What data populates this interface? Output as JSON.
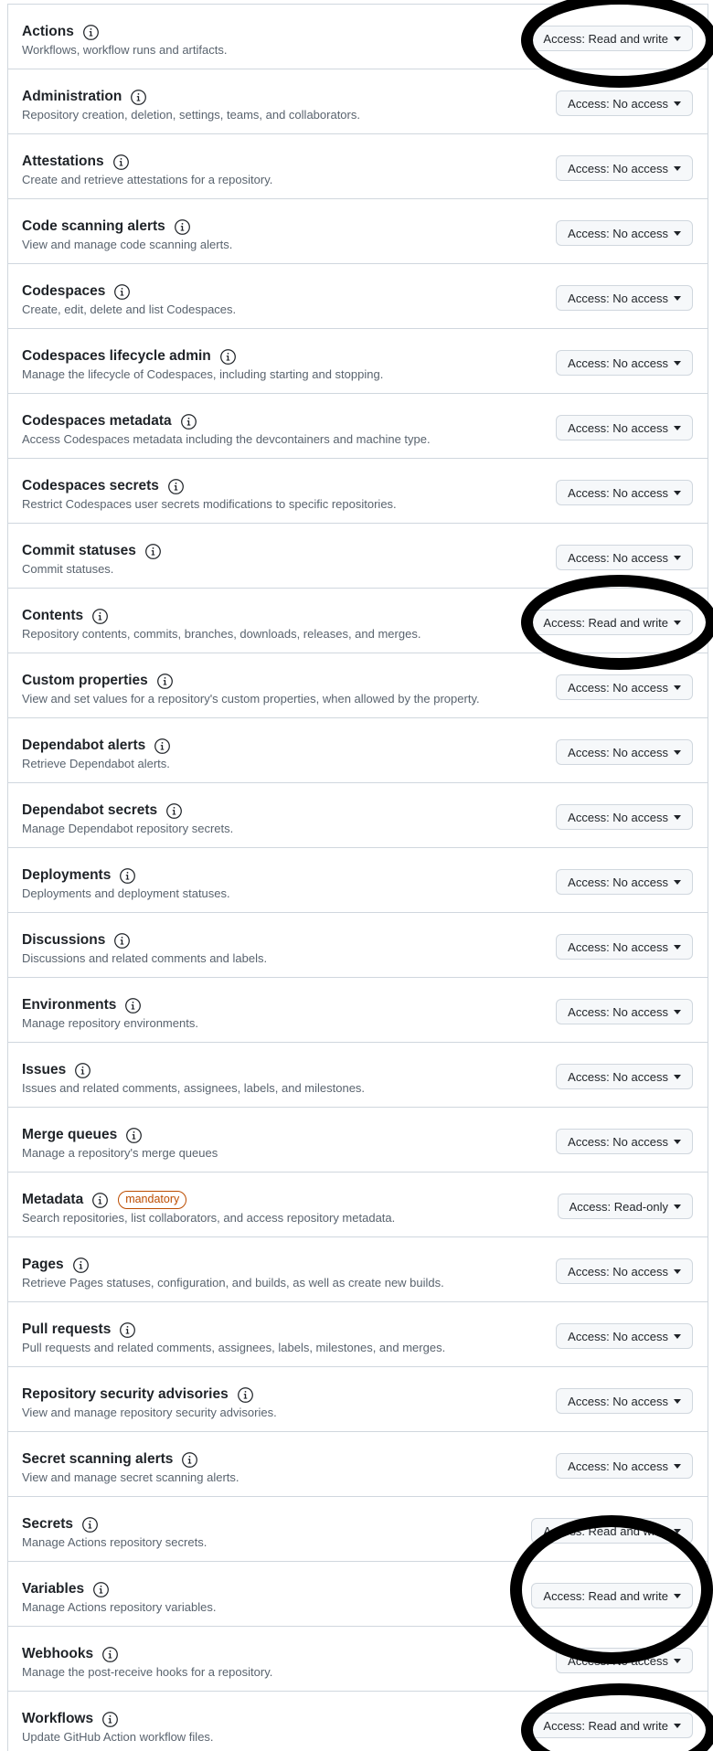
{
  "permissions": [
    {
      "name": "Actions",
      "description": "Workflows, workflow runs and artifacts.",
      "access": "Access: Read and write"
    },
    {
      "name": "Administration",
      "description": "Repository creation, deletion, settings, teams, and collaborators.",
      "access": "Access: No access"
    },
    {
      "name": "Attestations",
      "description": "Create and retrieve attestations for a repository.",
      "access": "Access: No access"
    },
    {
      "name": "Code scanning alerts",
      "description": "View and manage code scanning alerts.",
      "access": "Access: No access"
    },
    {
      "name": "Codespaces",
      "description": "Create, edit, delete and list Codespaces.",
      "access": "Access: No access"
    },
    {
      "name": "Codespaces lifecycle admin",
      "description": "Manage the lifecycle of Codespaces, including starting and stopping.",
      "access": "Access: No access"
    },
    {
      "name": "Codespaces metadata",
      "description": "Access Codespaces metadata including the devcontainers and machine type.",
      "access": "Access: No access"
    },
    {
      "name": "Codespaces secrets",
      "description": "Restrict Codespaces user secrets modifications to specific repositories.",
      "access": "Access: No access"
    },
    {
      "name": "Commit statuses",
      "description": "Commit statuses.",
      "access": "Access: No access"
    },
    {
      "name": "Contents",
      "description": "Repository contents, commits, branches, downloads, releases, and merges.",
      "access": "Access: Read and write"
    },
    {
      "name": "Custom properties",
      "description": "View and set values for a repository's custom properties, when allowed by the property.",
      "access": "Access: No access"
    },
    {
      "name": "Dependabot alerts",
      "description": "Retrieve Dependabot alerts.",
      "access": "Access: No access"
    },
    {
      "name": "Dependabot secrets",
      "description": "Manage Dependabot repository secrets.",
      "access": "Access: No access"
    },
    {
      "name": "Deployments",
      "description": "Deployments and deployment statuses.",
      "access": "Access: No access"
    },
    {
      "name": "Discussions",
      "description": "Discussions and related comments and labels.",
      "access": "Access: No access"
    },
    {
      "name": "Environments",
      "description": "Manage repository environments.",
      "access": "Access: No access"
    },
    {
      "name": "Issues",
      "description": "Issues and related comments, assignees, labels, and milestones.",
      "access": "Access: No access"
    },
    {
      "name": "Merge queues",
      "description": "Manage a repository's merge queues",
      "access": "Access: No access"
    },
    {
      "name": "Metadata",
      "badge": "mandatory",
      "description": "Search repositories, list collaborators, and access repository metadata.",
      "access": "Access: Read-only"
    },
    {
      "name": "Pages",
      "description": "Retrieve Pages statuses, configuration, and builds, as well as create new builds.",
      "access": "Access: No access"
    },
    {
      "name": "Pull requests",
      "description": "Pull requests and related comments, assignees, labels, milestones, and merges.",
      "access": "Access: No access"
    },
    {
      "name": "Repository security advisories",
      "description": "View and manage repository security advisories.",
      "access": "Access: No access"
    },
    {
      "name": "Secret scanning alerts",
      "description": "View and manage secret scanning alerts.",
      "access": "Access: No access"
    },
    {
      "name": "Secrets",
      "description": "Manage Actions repository secrets.",
      "access": "Access: Read and write"
    },
    {
      "name": "Variables",
      "description": "Manage Actions repository variables.",
      "access": "Access: Read and write"
    },
    {
      "name": "Webhooks",
      "description": "Manage the post-receive hooks for a repository.",
      "access": "Access: No access"
    },
    {
      "name": "Workflows",
      "description": "Update GitHub Action workflow files.",
      "access": "Access: Read and write"
    }
  ],
  "colors": {
    "border": "#d0d7de",
    "title": "#1f2328",
    "description": "#59636e",
    "button_bg": "#f6f8fa",
    "badge": "#bc4c00",
    "annotation_ring": "#000000"
  },
  "icons": {
    "row_info": "info-icon",
    "dropdown": "caret-down-icon"
  }
}
